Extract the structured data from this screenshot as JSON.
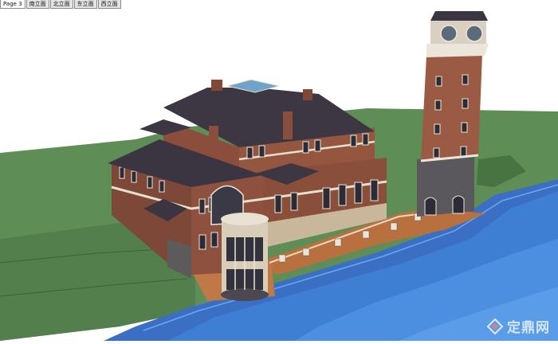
{
  "tabs": [
    {
      "label": "Page 3",
      "active": true
    },
    {
      "label": "南立面",
      "active": false
    },
    {
      "label": "北立面",
      "active": false
    },
    {
      "label": "东立面",
      "active": false
    },
    {
      "label": "西立面",
      "active": false
    }
  ],
  "viewport": {
    "description_colors": {
      "background": "#ffffff",
      "lawn": "#5f8e57",
      "water": "#3f74c8",
      "brick": "#8c4f3c",
      "roof": "#3b3540",
      "deck": "#b86f45"
    }
  },
  "watermark": {
    "icon": "ding-logo-icon",
    "text": "定鼎网"
  }
}
